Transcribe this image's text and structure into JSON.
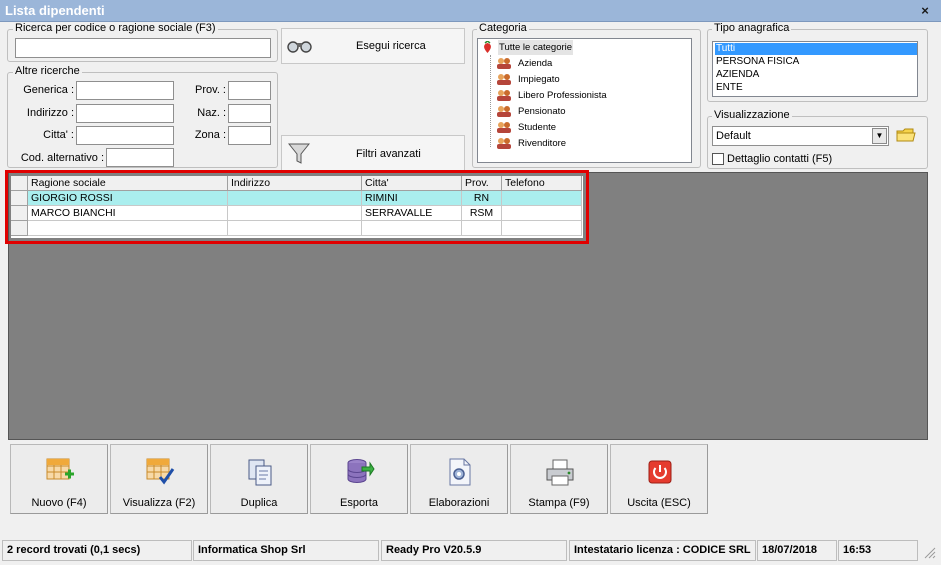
{
  "window": {
    "title": "Lista dipendenti",
    "close_glyph": "×"
  },
  "search": {
    "legend": "Ricerca per codice o ragione sociale (F3)",
    "value": "",
    "run_label": "Esegui ricerca"
  },
  "other": {
    "legend": "Altre ricerche",
    "generica_label": "Generica :",
    "indirizzo_label": "Indirizzo :",
    "citta_label": "Citta' :",
    "cod_label": "Cod. alternativo :",
    "prov_label": "Prov. :",
    "naz_label": "Naz. :",
    "zona_label": "Zona :"
  },
  "filters_label": "Filtri avanzati",
  "categoria": {
    "legend": "Categoria",
    "root": "Tutte le categorie",
    "items": [
      "Azienda",
      "Impiegato",
      "Libero Professionista",
      "Pensionato",
      "Studente",
      "Rivenditore"
    ]
  },
  "tipo": {
    "legend": "Tipo anagrafica",
    "items": [
      "Tutti",
      "PERSONA FISICA",
      "AZIENDA",
      "ENTE"
    ],
    "selected": "Tutti"
  },
  "visualizzazione": {
    "legend": "Visualizzazione",
    "value": "Default",
    "checkbox_label": "Dettaglio contatti (F5)"
  },
  "grid": {
    "columns": [
      "Ragione sociale",
      "Indirizzo",
      "Citta'",
      "Prov.",
      "Telefono"
    ],
    "rows": [
      [
        "GIORGIO ROSSI",
        "",
        "RIMINI",
        "RN",
        ""
      ],
      [
        "MARCO BIANCHI",
        "",
        "SERRAVALLE",
        "RSM",
        ""
      ],
      [
        "",
        "",
        "",
        "",
        ""
      ]
    ]
  },
  "toolbar": [
    "Nuovo (F4)",
    "Visualizza (F2)",
    "Duplica",
    "Esporta",
    "Elaborazioni",
    "Stampa (F9)",
    "Uscita (ESC)"
  ],
  "status": {
    "records": "2 record trovati (0,1 secs)",
    "company": "Informatica Shop Srl",
    "version": "Ready Pro V20.5.9",
    "license": "Intestatario licenza : CODICE SRL",
    "date": "18/07/2018",
    "time": "16:53"
  },
  "colors": {
    "titlebar": "#9bb6d9",
    "selection_row": "#aaeeee",
    "highlight": "#e00000",
    "grid_bg": "#808080"
  }
}
